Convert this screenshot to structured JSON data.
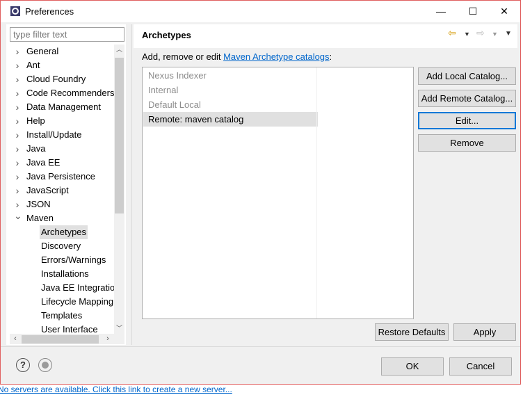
{
  "window": {
    "title": "Preferences",
    "minimize_glyph": "—",
    "maximize_glyph": "☐",
    "close_glyph": "✕",
    "icon": "eclipse-icon"
  },
  "filter": {
    "placeholder": "type filter text"
  },
  "tree": {
    "top_level": [
      "General",
      "Ant",
      "Cloud Foundry",
      "Code Recommenders",
      "Data Management",
      "Help",
      "Install/Update",
      "Java",
      "Java EE",
      "Java Persistence",
      "JavaScript",
      "JSON",
      "Maven"
    ],
    "maven_children": [
      "Archetypes",
      "Discovery",
      "Errors/Warnings",
      "Installations",
      "Java EE Integration",
      "Lifecycle Mapping",
      "Templates",
      "User Interface"
    ],
    "selected": "Archetypes"
  },
  "page": {
    "title": "Archetypes",
    "desc_prefix": "Add, remove or edit ",
    "desc_link": "Maven Archetype catalogs",
    "desc_suffix": ":"
  },
  "catalogs": [
    {
      "label": "Nexus Indexer",
      "enabled": false
    },
    {
      "label": "Internal",
      "enabled": false
    },
    {
      "label": "Default Local",
      "enabled": false
    },
    {
      "label": "Remote: maven catalog",
      "enabled": true,
      "selected": true
    }
  ],
  "buttons": {
    "add_local": "Add Local Catalog...",
    "add_remote": "Add Remote Catalog...",
    "edit": "Edit...",
    "remove": "Remove",
    "restore_defaults": "Restore Defaults",
    "apply": "Apply",
    "ok": "OK",
    "cancel": "Cancel"
  },
  "footer": {
    "help_glyph": "?",
    "status_text": "No servers are available. Click this link to create a new server..."
  }
}
